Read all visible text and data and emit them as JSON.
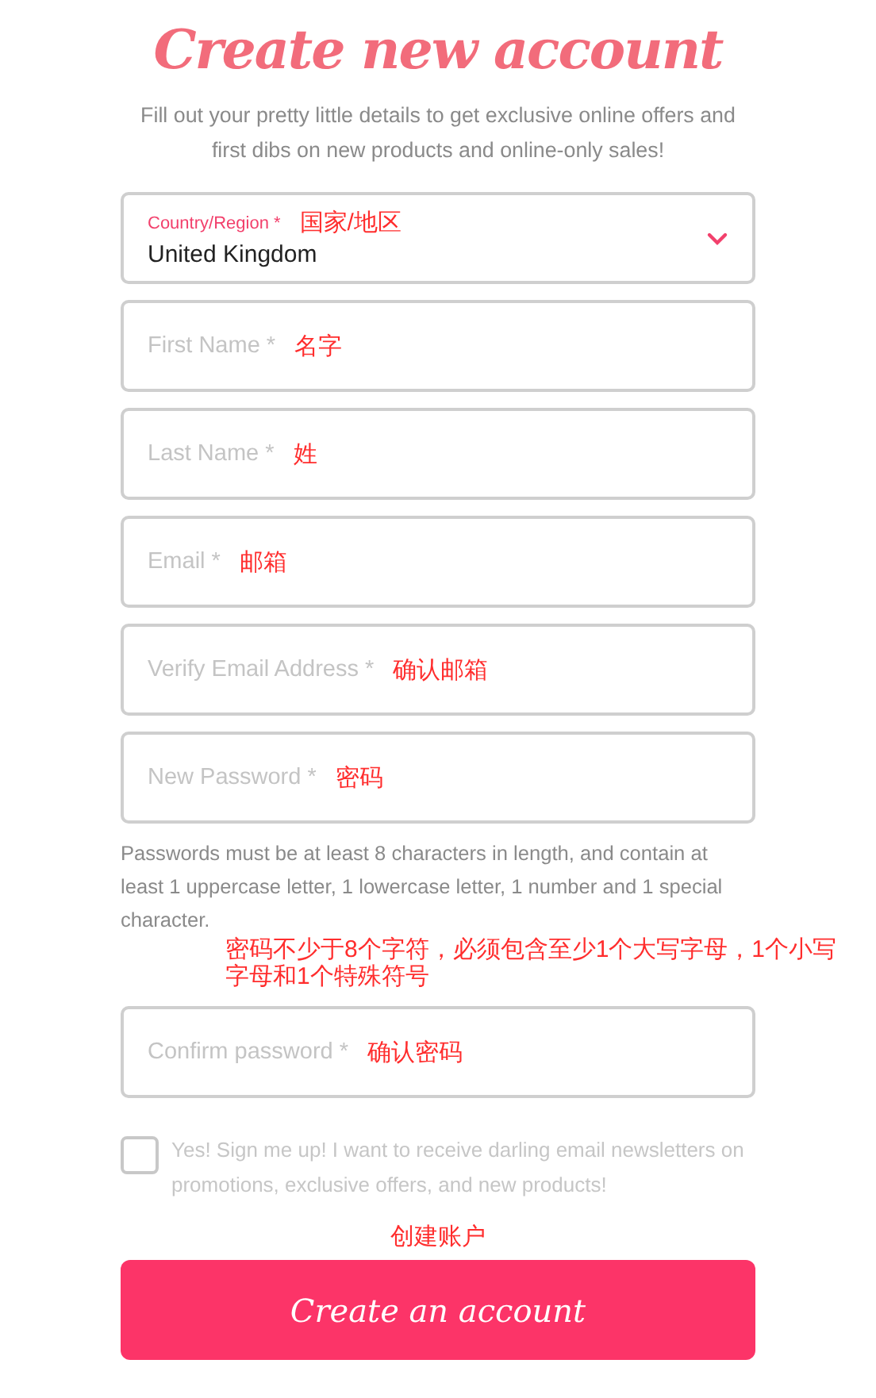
{
  "title": "Create new account",
  "subtitle": "Fill out your pretty little details to get exclusive online offers and first dibs on new products and online-only sales!",
  "items": [
    {
      "kind": "select",
      "label": "Country/Region *",
      "annotation": "国家/地区",
      "value": "United Kingdom"
    },
    {
      "kind": "text",
      "placeholder": "First Name *",
      "annotation": "名字"
    },
    {
      "kind": "text",
      "placeholder": "Last Name *",
      "annotation": "姓"
    },
    {
      "kind": "text",
      "placeholder": "Email *",
      "annotation": "邮箱"
    },
    {
      "kind": "text",
      "placeholder": "Verify Email Address *",
      "annotation": "确认邮箱"
    },
    {
      "kind": "text",
      "placeholder": "New Password *",
      "annotation": "密码"
    },
    {
      "kind": "hint",
      "text": "Passwords must be at least 8 characters in length, and contain at least 1 uppercase letter, 1 lowercase letter, 1 number and 1 special character.",
      "annotation": "密码不少于8个字符，必须包含至少1个大写字母，1个小写字母和1个特殊符号"
    },
    {
      "kind": "text",
      "placeholder": "Confirm password *",
      "annotation": "确认密码"
    }
  ],
  "newsletter": {
    "label": "Yes! Sign me up! I want to receive darling email newsletters on promotions, exclusive offers, and new products!",
    "checked": false
  },
  "submit": {
    "annotation": "创建账户",
    "label": "Create an account"
  }
}
